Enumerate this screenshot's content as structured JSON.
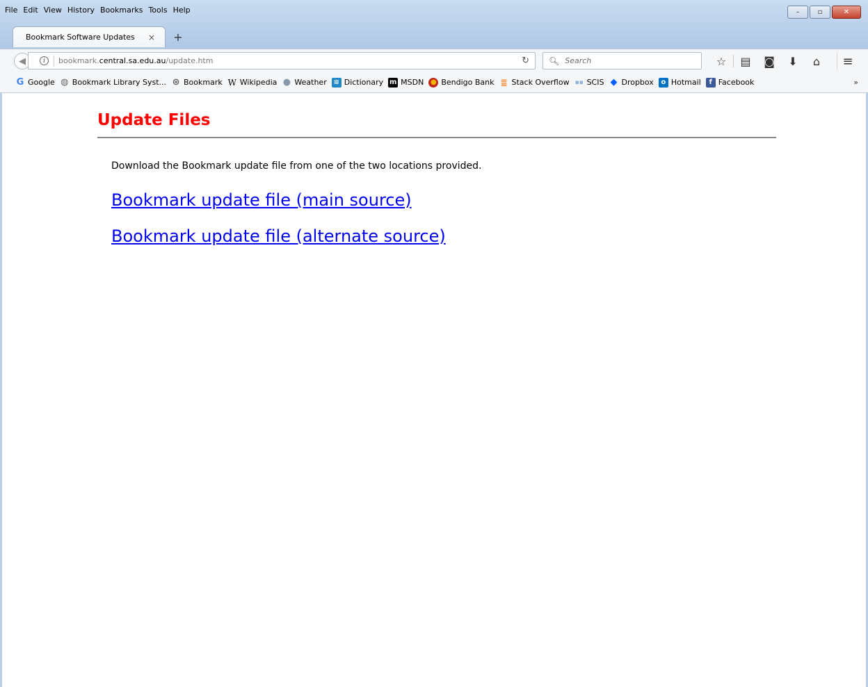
{
  "menu": [
    {
      "label": "File"
    },
    {
      "label": "Edit"
    },
    {
      "label": "View"
    },
    {
      "label": "History"
    },
    {
      "label": "Bookmarks"
    },
    {
      "label": "Tools"
    },
    {
      "label": "Help"
    }
  ],
  "window_controls": {
    "minimize": "–",
    "restore": "▫",
    "close": "✕"
  },
  "tab": {
    "title": "Bookmark Software Updates",
    "close": "×",
    "new_tab": "+"
  },
  "navbar": {
    "url_prefix": "bookmark.",
    "url_domain": "central.sa.edu.au",
    "url_path": "/update.htm",
    "search_placeholder": "Search"
  },
  "bookmarks": [
    {
      "label": "Google",
      "icon": "google-icon",
      "color": "#4285f4"
    },
    {
      "label": "Bookmark Library Syst...",
      "icon": "globe-icon",
      "color": "#666666"
    },
    {
      "label": "Bookmark",
      "icon": "bookmark-logo-icon",
      "color": "#666666"
    },
    {
      "label": "Wikipedia",
      "icon": "wikipedia-icon",
      "color": "#000000"
    },
    {
      "label": "Weather",
      "icon": "weather-icon",
      "color": "#8899aa"
    },
    {
      "label": "Dictionary",
      "icon": "dictionary-icon",
      "color": "#1e88c7"
    },
    {
      "label": "MSDN",
      "icon": "msdn-icon",
      "color": "#000000"
    },
    {
      "label": "Bendigo Bank",
      "icon": "bendigo-icon",
      "color": "#c0281c"
    },
    {
      "label": "Stack Overflow",
      "icon": "stackoverflow-icon",
      "color": "#f48024"
    },
    {
      "label": "SCIS",
      "icon": "scis-icon",
      "color": "#8fb4d9"
    },
    {
      "label": "Dropbox",
      "icon": "dropbox-icon",
      "color": "#0061fe"
    },
    {
      "label": "Hotmail",
      "icon": "outlook-icon",
      "color": "#0072c6"
    },
    {
      "label": "Facebook",
      "icon": "facebook-icon",
      "color": "#3b5998"
    }
  ],
  "page": {
    "title": "Update Files",
    "intro": "Download the Bookmark update file from one of the two locations provided.",
    "link_main": "Bookmark update file (main source)",
    "link_alt": "Bookmark update file (alternate source)"
  },
  "colors": {
    "title": "#ff0000",
    "link": "#0000ee",
    "chrome": "#b9d0ea"
  }
}
